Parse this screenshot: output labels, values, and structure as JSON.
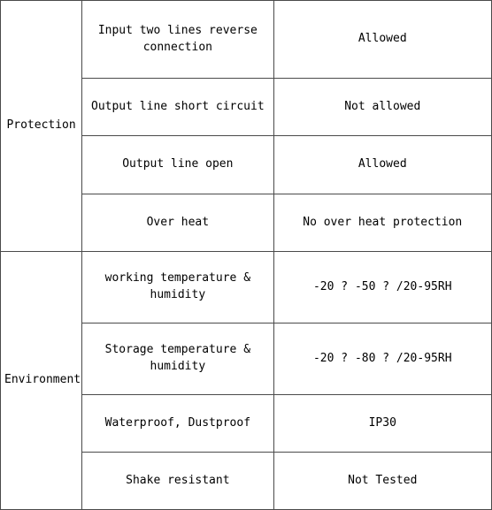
{
  "table": {
    "columns": [
      "group",
      "item",
      "value"
    ],
    "groups": [
      {
        "name": "Protection",
        "rows": [
          {
            "item": "Input two lines reverse connection",
            "value": "Allowed"
          },
          {
            "item": "Output line short circuit",
            "value": "Not allowed"
          },
          {
            "item": "Output line open",
            "value": "Allowed"
          },
          {
            "item": "Over heat",
            "value": "No over heat protection"
          }
        ]
      },
      {
        "name": "Environment",
        "rows": [
          {
            "item": "working temperature & humidity",
            "value": "-20 ? -50 ? /20-95RH"
          },
          {
            "item": "Storage temperature & humidity",
            "value": "-20 ? -80 ? /20-95RH"
          },
          {
            "item": "Waterproof, Dustproof",
            "value": "IP30"
          },
          {
            "item": "Shake resistant",
            "value": "Not Tested"
          }
        ]
      }
    ]
  },
  "colors": {
    "inner_border": "#4a4a4a",
    "outer_border": "#9a9a9a",
    "text": "#000000",
    "background": "#ffffff"
  }
}
